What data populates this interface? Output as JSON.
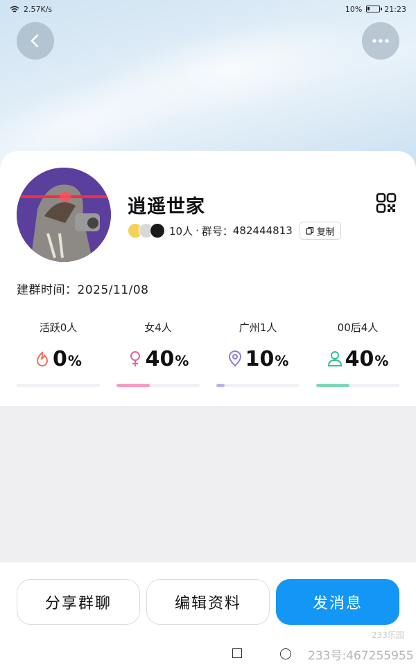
{
  "status_bar": {
    "network_speed": "2.57K/s",
    "battery": "10%",
    "time": "21:23"
  },
  "icons": {
    "back": "chevron-left-icon",
    "more": "more-horizontal-icon",
    "qr": "qr-code-icon",
    "copy": "copy-icon"
  },
  "group": {
    "name": "逍遥世家",
    "member_count": "10人",
    "separator": "·",
    "id_label": "群号：",
    "id_value": "482444813",
    "copy_label": "复制",
    "created_label": "建群时间：",
    "created_date": "2025/11/08"
  },
  "stats": [
    {
      "label": "活跃0人",
      "value": "0",
      "unit": "%",
      "percent": 0,
      "icon": "flame-icon",
      "color": "#f0705a",
      "bar_color": "#f0705a"
    },
    {
      "label": "女4人",
      "value": "40",
      "unit": "%",
      "percent": 40,
      "icon": "female-icon",
      "color": "#ec5fa0",
      "bar_color": "#f59cc4"
    },
    {
      "label": "广州1人",
      "value": "10",
      "unit": "%",
      "percent": 10,
      "icon": "location-pin-icon",
      "color": "#8a7fd8",
      "bar_color": "#b9b1ee"
    },
    {
      "label": "00后4人",
      "value": "40",
      "unit": "%",
      "percent": 40,
      "icon": "person-icon",
      "color": "#35c08f",
      "bar_color": "#7ed7b5"
    }
  ],
  "actions": {
    "share": "分享群聊",
    "edit": "编辑资料",
    "send": "发消息"
  },
  "colors": {
    "primary": "#1396f6"
  },
  "watermark": {
    "top": "233乐园",
    "bottom": "233号:467255955"
  }
}
